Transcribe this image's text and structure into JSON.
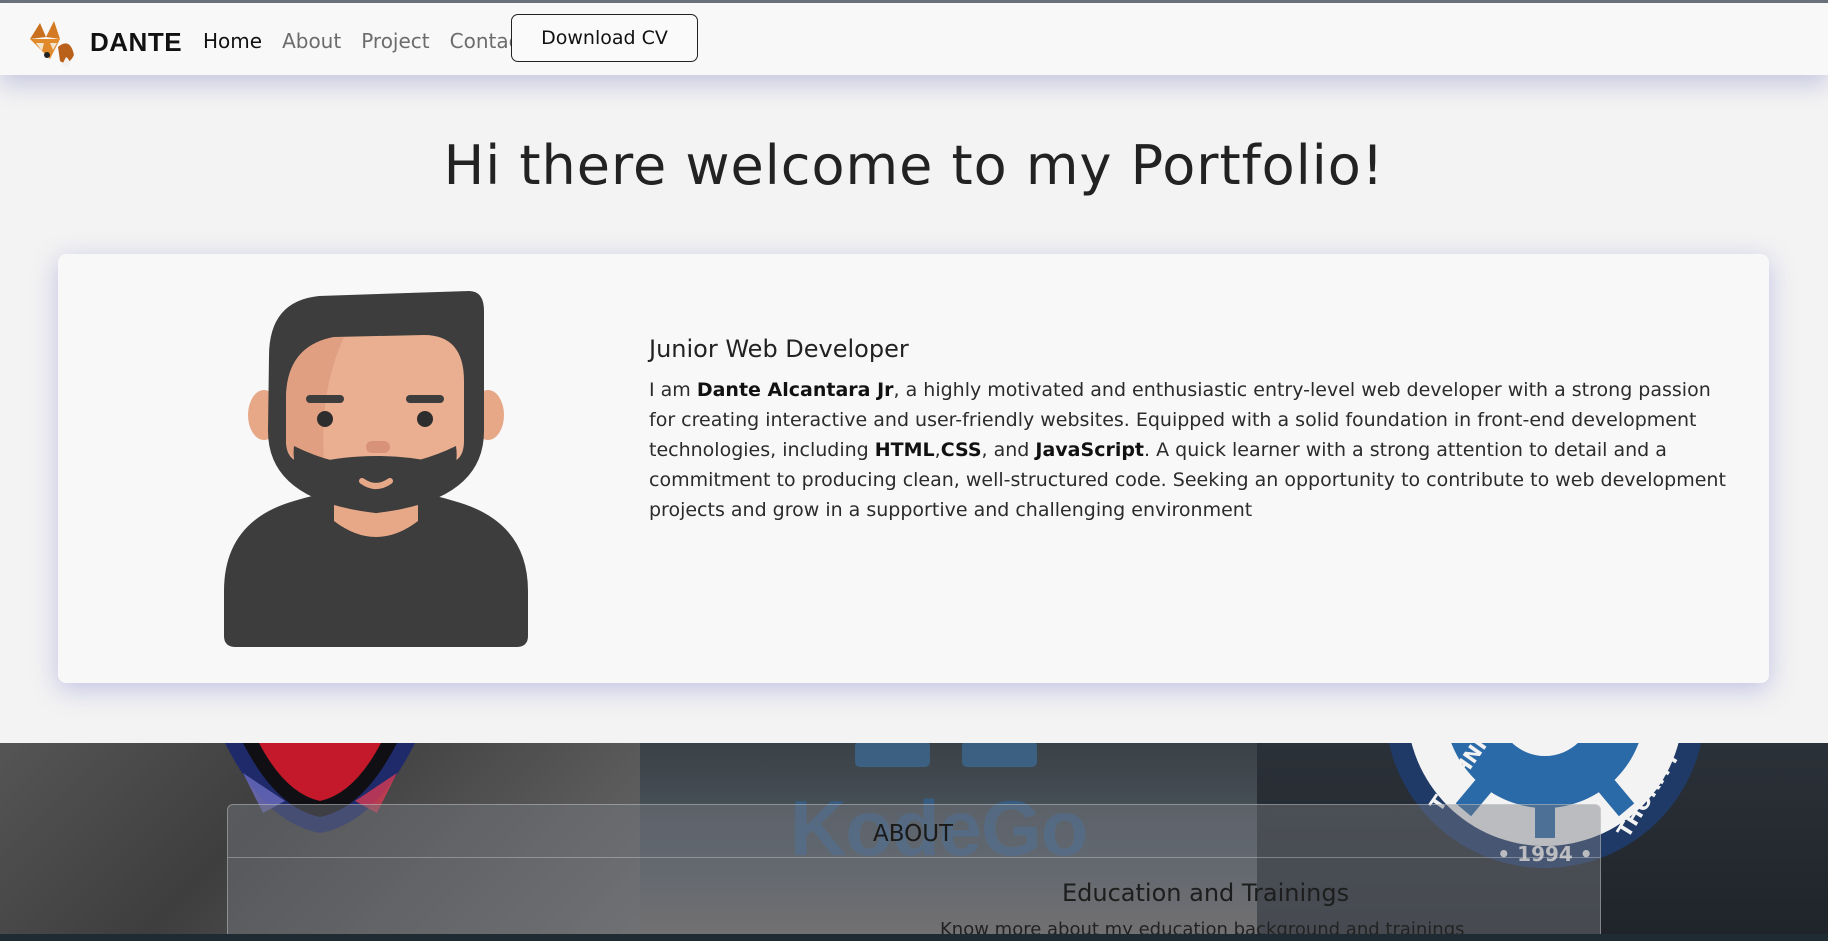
{
  "nav": {
    "brand": "DANTE",
    "links": [
      "Home",
      "About",
      "Project",
      "Contact"
    ],
    "cv_button": "Download CV"
  },
  "hero": {
    "title": "Hi there welcome to my Portfolio!"
  },
  "intro": {
    "role": "Junior Web Developer",
    "desc_p1": "I am ",
    "name": "Dante Alcantara Jr",
    "desc_p2": ", a highly motivated and enthusiastic entry-level web developer with a strong passion for creating interactive and user-friendly websites. Equipped with a solid foundation in front-end development technologies, including ",
    "tech1": "HTML",
    "sep1": ",",
    "tech2": "CSS",
    "sep2": ", and ",
    "tech3": "JavaScript",
    "desc_p3": ". A quick learner with a strong attention to detail and a commitment to producing clean, well-structured code. Seeking an opportunity to contribute to web development projects and grow in a supportive and challenging environment"
  },
  "about": {
    "heading": "ABOUT",
    "edu_title": "Education and Trainings",
    "edu_sub": "Know more about my education background and trainings",
    "kodego_text": "KodeGo",
    "seal_year": "• 1994 •",
    "seal_text": "TECHNI",
    "seal_text2": "THORITY"
  },
  "colors": {
    "accent_text": "#212529",
    "nav_shadow": "#5a5fb4",
    "kodego_blue": "#2d6aa8"
  }
}
